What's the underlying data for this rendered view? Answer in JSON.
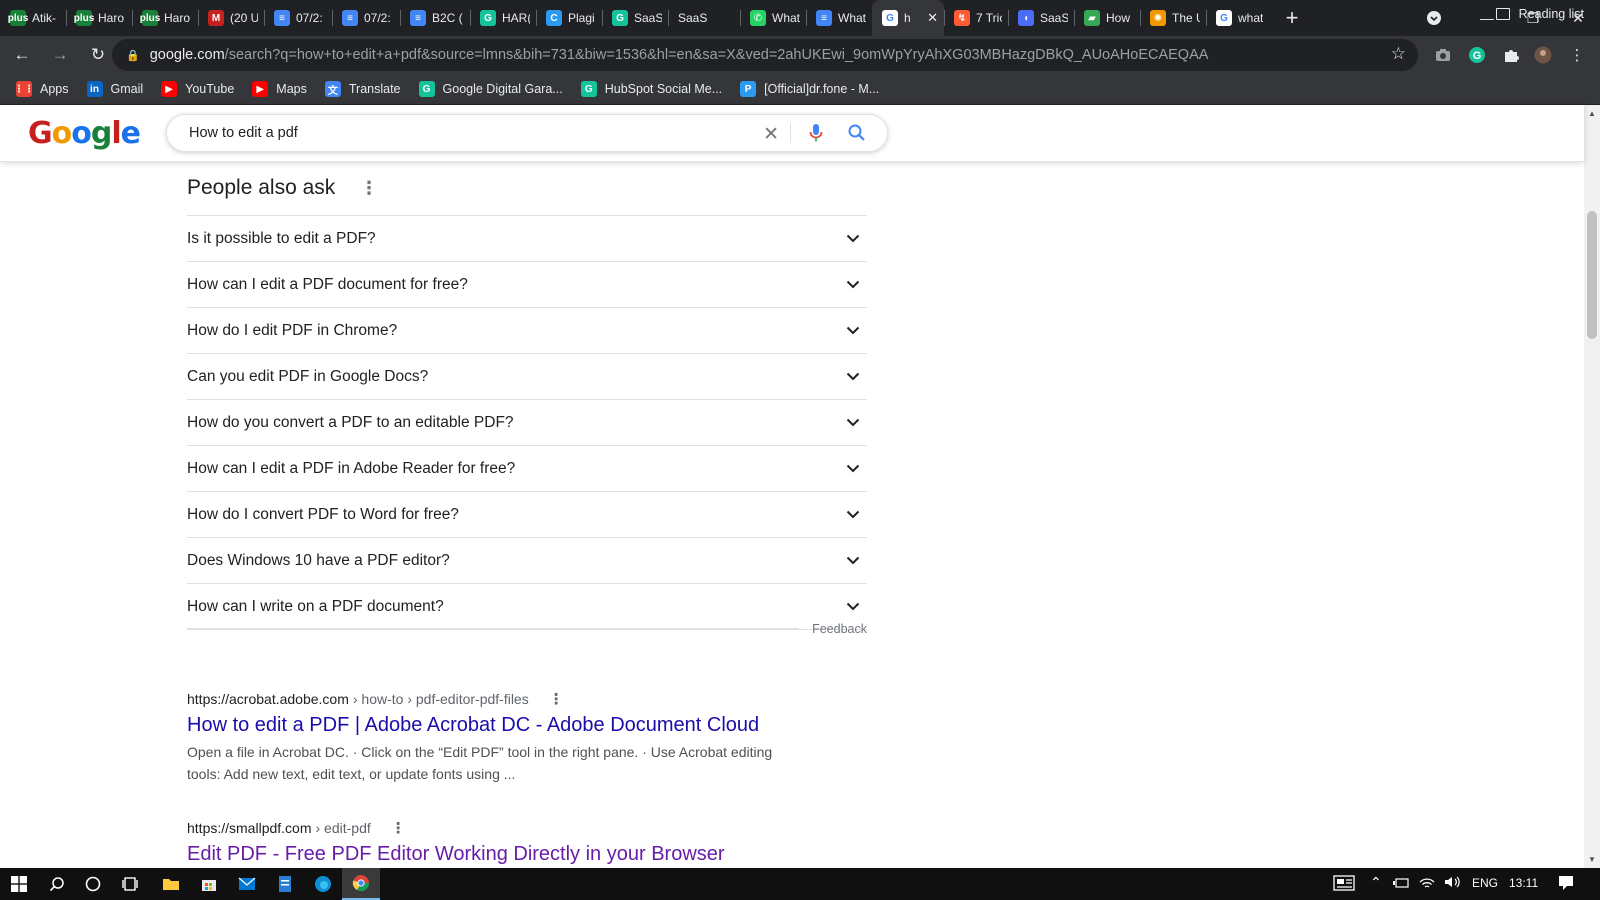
{
  "browser": {
    "tabs": [
      {
        "title": "Atik-",
        "icon": "plus",
        "color": "#188038"
      },
      {
        "title": "Haro",
        "icon": "plus",
        "color": "#188038"
      },
      {
        "title": "Haro",
        "icon": "plus",
        "color": "#188038"
      },
      {
        "title": "(20 U",
        "icon": "M",
        "color": "#c5221f"
      },
      {
        "title": "07/2:",
        "icon": "≡",
        "color": "#4285f4"
      },
      {
        "title": "07/2:",
        "icon": "≡",
        "color": "#4285f4"
      },
      {
        "title": "B2C (",
        "icon": "≡",
        "color": "#4285f4"
      },
      {
        "title": "HAR(",
        "icon": "G",
        "color": "#15c39a"
      },
      {
        "title": "Plagi",
        "icon": "C",
        "color": "#2b9af3"
      },
      {
        "title": "SaaS",
        "icon": "G",
        "color": "#15c39a"
      },
      {
        "title": "SaaS",
        "icon": "",
        "color": "#202124"
      },
      {
        "title": "What",
        "icon": "✆",
        "color": "#25d366"
      },
      {
        "title": "What",
        "icon": "≡",
        "color": "#4285f4"
      },
      {
        "title": "h",
        "icon": "G",
        "color": "#ffffff",
        "active": true
      },
      {
        "title": "7 Tric",
        "icon": "↯",
        "color": "#ff5c35"
      },
      {
        "title": "SaaS",
        "icon": "◖",
        "color": "#4a6cf7"
      },
      {
        "title": "How",
        "icon": "▰",
        "color": "#34a853"
      },
      {
        "title": "The U",
        "icon": "✺",
        "color": "#f29900"
      },
      {
        "title": "what",
        "icon": "G",
        "color": "#ffffff"
      }
    ],
    "new_tab_icon": "+",
    "tab_close_icon": "✕",
    "url_host": "google.com",
    "url_path": "/search?q=how+to+edit+a+pdf&source=lmns&bih=731&biw=1536&hl=en&sa=X&ved=2ahUKEwi_9omWpYryAhXG03MBHazgDBkQ_AUoAHoECAEQAA",
    "bookmarks": [
      {
        "label": "Apps",
        "icon": "⋮⋮",
        "color": "#ea4335"
      },
      {
        "label": "Gmail",
        "icon": "in",
        "color": "#0a66c2"
      },
      {
        "label": "YouTube",
        "icon": "▶",
        "color": "#ff0000"
      },
      {
        "label": "Maps",
        "icon": "▶",
        "color": "#ff0000"
      },
      {
        "label": "Translate",
        "icon": "文",
        "color": "#4285f4"
      },
      {
        "label": "Google Digital Gara...",
        "icon": "G",
        "color": "#15c39a"
      },
      {
        "label": "HubSpot Social Me...",
        "icon": "G",
        "color": "#15c39a"
      },
      {
        "label": "[Official]dr.fone - M...",
        "icon": "P",
        "color": "#2b9af3"
      }
    ],
    "reading_list": "Reading list"
  },
  "search": {
    "logo_letters": [
      "G",
      "o",
      "o",
      "g",
      "l",
      "e"
    ],
    "query": "How to edit a pdf"
  },
  "people_also_ask": {
    "title": "People also ask",
    "questions": [
      "Is it possible to edit a PDF?",
      "How can I edit a PDF document for free?",
      "How do I edit PDF in Chrome?",
      "Can you edit PDF in Google Docs?",
      "How do you convert a PDF to an editable PDF?",
      "How can I edit a PDF in Adobe Reader for free?",
      "How do I convert PDF to Word for free?",
      "Does Windows 10 have a PDF editor?",
      "How can I write on a PDF document?"
    ],
    "feedback": "Feedback"
  },
  "results": [
    {
      "url_host": "https://acrobat.adobe.com",
      "url_path": "› how-to › pdf-editor-pdf-files",
      "title": "How to edit a PDF | Adobe Acrobat DC - Adobe Document Cloud",
      "snippet": "Open a file in Acrobat DC. · Click on the “Edit PDF” tool in the right pane. · Use Acrobat editing tools: Add new text, edit text, or update fonts using ..."
    },
    {
      "url_host": "https://smallpdf.com",
      "url_path": "› edit-pdf",
      "title": "Edit PDF - Free PDF Editor Working Directly in your Browser",
      "snippet": ""
    }
  ],
  "taskbar": {
    "language": "ENG",
    "time": "13:11"
  },
  "colors": {
    "link": "#1a0dab",
    "visited_link": "#681da8",
    "browser_dark": "#202124",
    "toolbar": "#35363a"
  }
}
